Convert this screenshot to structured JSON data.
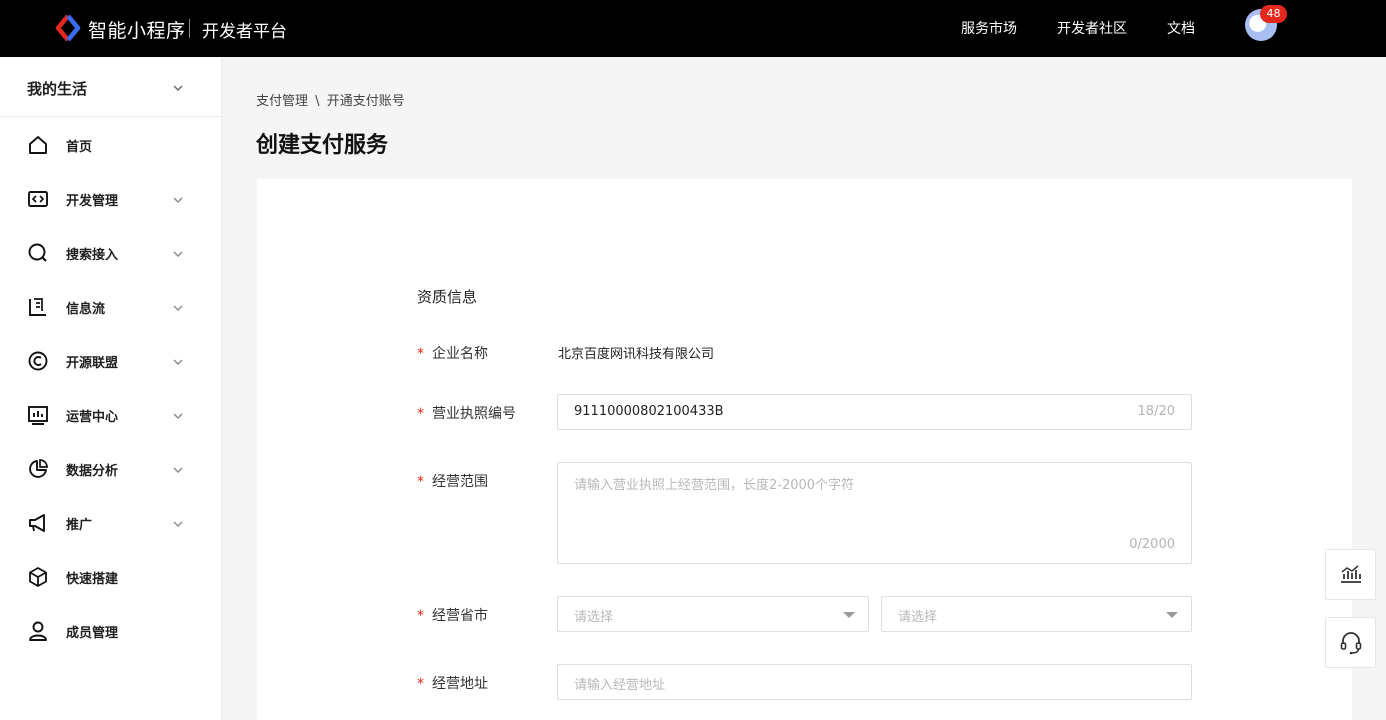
{
  "header": {
    "brand": "智能小程序",
    "subtitle": "开发者平台",
    "links": [
      "服务市场",
      "开发者社区",
      "文档"
    ],
    "notification_count": "48"
  },
  "sidebar": {
    "app_name": "我的生活",
    "items": [
      {
        "label": "首页",
        "icon": "home-icon"
      },
      {
        "label": "开发管理",
        "icon": "code-icon"
      },
      {
        "label": "搜索接入",
        "icon": "search-icon"
      },
      {
        "label": "信息流",
        "icon": "feed-icon"
      },
      {
        "label": "开源联盟",
        "icon": "open-source-icon"
      },
      {
        "label": "运营中心",
        "icon": "operation-icon"
      },
      {
        "label": "数据分析",
        "icon": "pie-chart-icon"
      },
      {
        "label": "推广",
        "icon": "megaphone-icon"
      },
      {
        "label": "快速搭建",
        "icon": "cube-icon"
      },
      {
        "label": "成员管理",
        "icon": "user-icon"
      }
    ]
  },
  "breadcrumb": {
    "parent": "支付管理",
    "separator": "\\",
    "current": "开通支付账号"
  },
  "page_title": "创建支付服务",
  "form": {
    "section_title": "资质信息",
    "required_mark": "*",
    "company": {
      "label": "企业名称",
      "value": "北京百度网讯科技有限公司"
    },
    "license": {
      "label": "营业执照编号",
      "value": "91110000802100433B",
      "counter": "18/20"
    },
    "scope": {
      "label": "经营范围",
      "placeholder": "请输入营业执照上经营范围，长度2-2000个字符",
      "counter": "0/2000"
    },
    "region": {
      "label": "经营省市",
      "province_placeholder": "请选择",
      "city_placeholder": "请选择"
    },
    "address": {
      "label": "经营地址",
      "placeholder": "请输入经营地址"
    }
  },
  "floating": [
    "chart-icon",
    "headset-icon"
  ],
  "colors": {
    "accent_red": "#e4281e",
    "logo_blue": "#3a6cf4",
    "topbar": "#000000"
  }
}
